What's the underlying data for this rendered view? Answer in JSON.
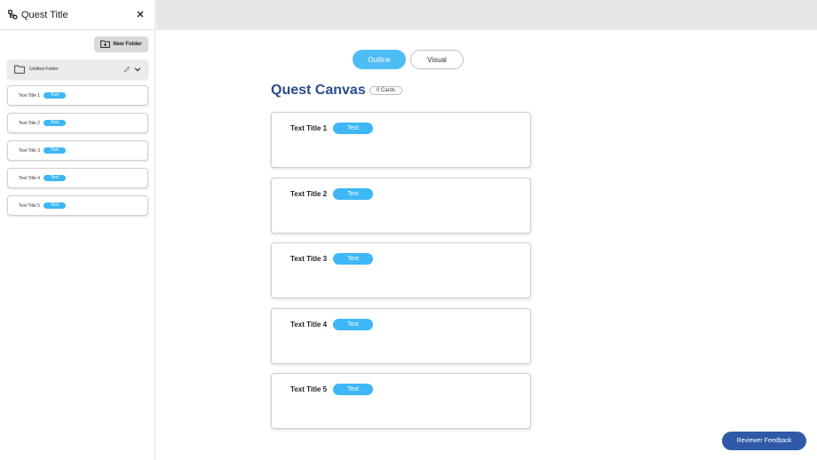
{
  "sidebar": {
    "title": "Quest Title",
    "logo_icon": "quest-tree-icon",
    "close_icon": "close-icon",
    "new_folder_label": "New Folder",
    "folder": {
      "label": "Untitled Folder"
    },
    "items": [
      {
        "title": "Text Title 1",
        "tag": "Text"
      },
      {
        "title": "Text Title 2",
        "tag": "Text"
      },
      {
        "title": "Text Title 3",
        "tag": "Text"
      },
      {
        "title": "Text Title 4",
        "tag": "Text"
      },
      {
        "title": "Text Title 5",
        "tag": "Text"
      }
    ]
  },
  "view_toggle": {
    "outline": "Outline",
    "visual": "Visual",
    "active": "Outline"
  },
  "canvas": {
    "title": "Quest Canvas",
    "card_count": "0 Cards",
    "cards": [
      {
        "title": "Text Title 1",
        "tag": "Text"
      },
      {
        "title": "Text Title 2",
        "tag": "Text"
      },
      {
        "title": "Text Title 3",
        "tag": "Text"
      },
      {
        "title": "Text Title 4",
        "tag": "Text"
      },
      {
        "title": "Text Title 5",
        "tag": "Text"
      }
    ]
  },
  "feedback_button": "Reviewer Feedback",
  "colors": {
    "accent": "#3db7f5",
    "title_blue": "#2b4d8f",
    "feedback_bg": "#2f5aa8",
    "topbar": "#e6e6e6"
  }
}
